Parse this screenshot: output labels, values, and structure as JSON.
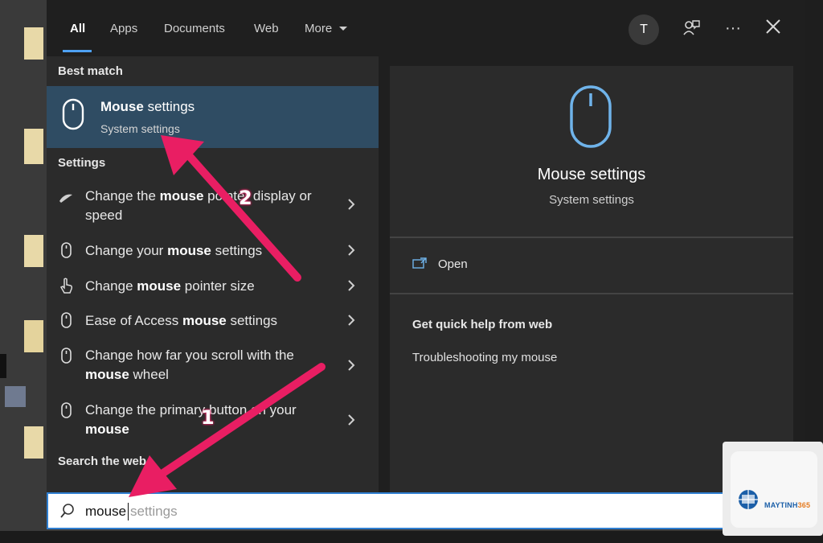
{
  "tabs": [
    {
      "label": "All",
      "active": true
    },
    {
      "label": "Apps"
    },
    {
      "label": "Documents"
    },
    {
      "label": "Web"
    },
    {
      "label": "More"
    }
  ],
  "topbar": {
    "avatar_letter": "T",
    "icons": [
      "feedback-icon",
      "more-options-icon",
      "close-icon"
    ]
  },
  "best_match": {
    "heading": "Best match",
    "title_bold": "Mouse",
    "title_rest": " settings",
    "subtitle": "System settings",
    "icon": "mouse-icon"
  },
  "settings": {
    "heading": "Settings",
    "items": [
      {
        "pre": "Change the ",
        "bold": "mouse",
        "post": " pointer display or speed",
        "icon": "pointer-icon"
      },
      {
        "pre": "Change your ",
        "bold": "mouse",
        "post": " settings",
        "icon": "mouse-icon"
      },
      {
        "pre": "Change ",
        "bold": "mouse",
        "post": " pointer size",
        "icon": "hand-pointer-icon"
      },
      {
        "pre": "Ease of Access ",
        "bold": "mouse",
        "post": " settings",
        "icon": "mouse-icon"
      },
      {
        "pre": "Change how far you scroll with the ",
        "bold": "mouse",
        "post": " wheel",
        "icon": "mouse-icon"
      },
      {
        "pre": "Change the primary button on your ",
        "bold": "mouse",
        "post": "",
        "icon": "mouse-icon"
      }
    ]
  },
  "search_web": {
    "heading": "Search the web"
  },
  "detail": {
    "title": "Mouse settings",
    "subtitle": "System settings",
    "open_label": "Open",
    "help_heading": "Get quick help from web",
    "help_link": "Troubleshooting my mouse"
  },
  "search": {
    "typed": "mouse",
    "suggestion": "settings"
  },
  "annotations": {
    "badge_1": "1",
    "badge_2": "2",
    "color": "#e91e63"
  },
  "logo": {
    "brand_a": "MAYTINH",
    "brand_b": "365"
  },
  "colors": {
    "accent": "#4ea1f3",
    "selected": "#2f4c63",
    "arrow": "#e91e63"
  }
}
